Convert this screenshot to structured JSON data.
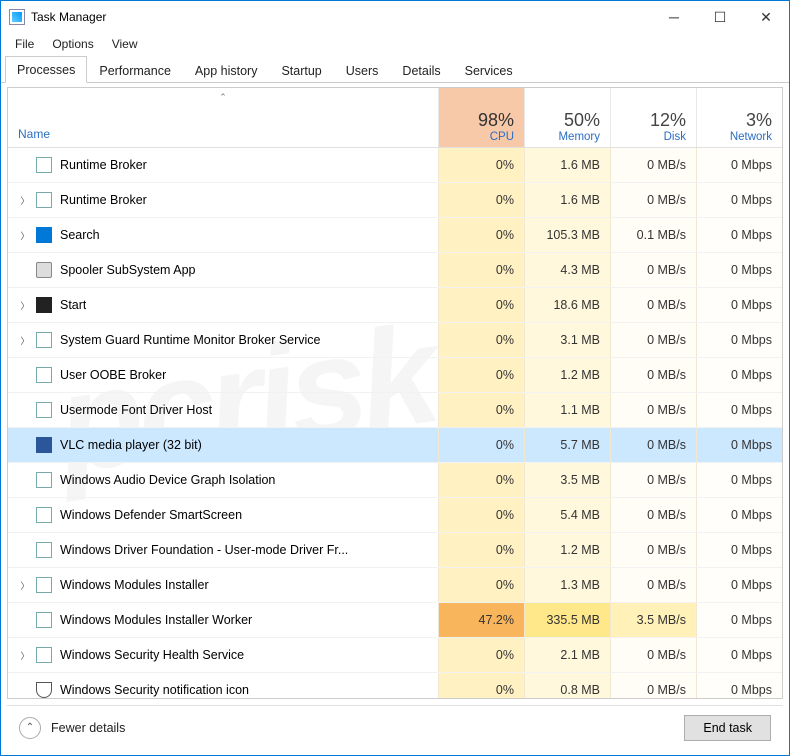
{
  "window": {
    "title": "Task Manager"
  },
  "menu": [
    "File",
    "Options",
    "View"
  ],
  "tabs": [
    "Processes",
    "Performance",
    "App history",
    "Startup",
    "Users",
    "Details",
    "Services"
  ],
  "active_tab": 0,
  "cols": {
    "name": "Name",
    "cpu": {
      "pct": "98%",
      "lbl": "CPU"
    },
    "mem": {
      "pct": "50%",
      "lbl": "Memory"
    },
    "disk": {
      "pct": "12%",
      "lbl": "Disk"
    },
    "net": {
      "pct": "3%",
      "lbl": "Network"
    }
  },
  "rows": [
    {
      "exp": false,
      "icon": "app",
      "name": "Runtime Broker",
      "cpu": "0%",
      "mem": "1.6 MB",
      "disk": "0 MB/s",
      "net": "0 Mbps"
    },
    {
      "exp": true,
      "icon": "app",
      "name": "Runtime Broker",
      "cpu": "0%",
      "mem": "1.6 MB",
      "disk": "0 MB/s",
      "net": "0 Mbps"
    },
    {
      "exp": true,
      "icon": "blue",
      "name": "Search",
      "cpu": "0%",
      "mem": "105.3 MB",
      "disk": "0.1 MB/s",
      "net": "0 Mbps"
    },
    {
      "exp": false,
      "icon": "printer",
      "name": "Spooler SubSystem App",
      "cpu": "0%",
      "mem": "4.3 MB",
      "disk": "0 MB/s",
      "net": "0 Mbps"
    },
    {
      "exp": true,
      "icon": "dark",
      "name": "Start",
      "cpu": "0%",
      "mem": "18.6 MB",
      "disk": "0 MB/s",
      "net": "0 Mbps"
    },
    {
      "exp": true,
      "icon": "app",
      "name": "System Guard Runtime Monitor Broker Service",
      "cpu": "0%",
      "mem": "3.1 MB",
      "disk": "0 MB/s",
      "net": "0 Mbps"
    },
    {
      "exp": false,
      "icon": "app",
      "name": "User OOBE Broker",
      "cpu": "0%",
      "mem": "1.2 MB",
      "disk": "0 MB/s",
      "net": "0 Mbps"
    },
    {
      "exp": false,
      "icon": "app",
      "name": "Usermode Font Driver Host",
      "cpu": "0%",
      "mem": "1.1 MB",
      "disk": "0 MB/s",
      "net": "0 Mbps"
    },
    {
      "exp": false,
      "icon": "word",
      "name": "VLC media player (32 bit)",
      "cpu": "0%",
      "mem": "5.7 MB",
      "disk": "0 MB/s",
      "net": "0 Mbps",
      "sel": true
    },
    {
      "exp": false,
      "icon": "app",
      "name": "Windows Audio Device Graph Isolation",
      "cpu": "0%",
      "mem": "3.5 MB",
      "disk": "0 MB/s",
      "net": "0 Mbps"
    },
    {
      "exp": false,
      "icon": "app",
      "name": "Windows Defender SmartScreen",
      "cpu": "0%",
      "mem": "5.4 MB",
      "disk": "0 MB/s",
      "net": "0 Mbps"
    },
    {
      "exp": false,
      "icon": "app",
      "name": "Windows Driver Foundation - User-mode Driver Fr...",
      "cpu": "0%",
      "mem": "1.2 MB",
      "disk": "0 MB/s",
      "net": "0 Mbps"
    },
    {
      "exp": true,
      "icon": "app",
      "name": "Windows Modules Installer",
      "cpu": "0%",
      "mem": "1.3 MB",
      "disk": "0 MB/s",
      "net": "0 Mbps"
    },
    {
      "exp": false,
      "icon": "app",
      "name": "Windows Modules Installer Worker",
      "cpu": "47.2%",
      "mem": "335.5 MB",
      "disk": "3.5 MB/s",
      "net": "0 Mbps",
      "hot": true
    },
    {
      "exp": true,
      "icon": "app",
      "name": "Windows Security Health Service",
      "cpu": "0%",
      "mem": "2.1 MB",
      "disk": "0 MB/s",
      "net": "0 Mbps"
    },
    {
      "exp": false,
      "icon": "shield",
      "name": "Windows Security notification icon",
      "cpu": "0%",
      "mem": "0.8 MB",
      "disk": "0 MB/s",
      "net": "0 Mbps"
    }
  ],
  "footer": {
    "fewer": "Fewer details",
    "end": "End task"
  }
}
